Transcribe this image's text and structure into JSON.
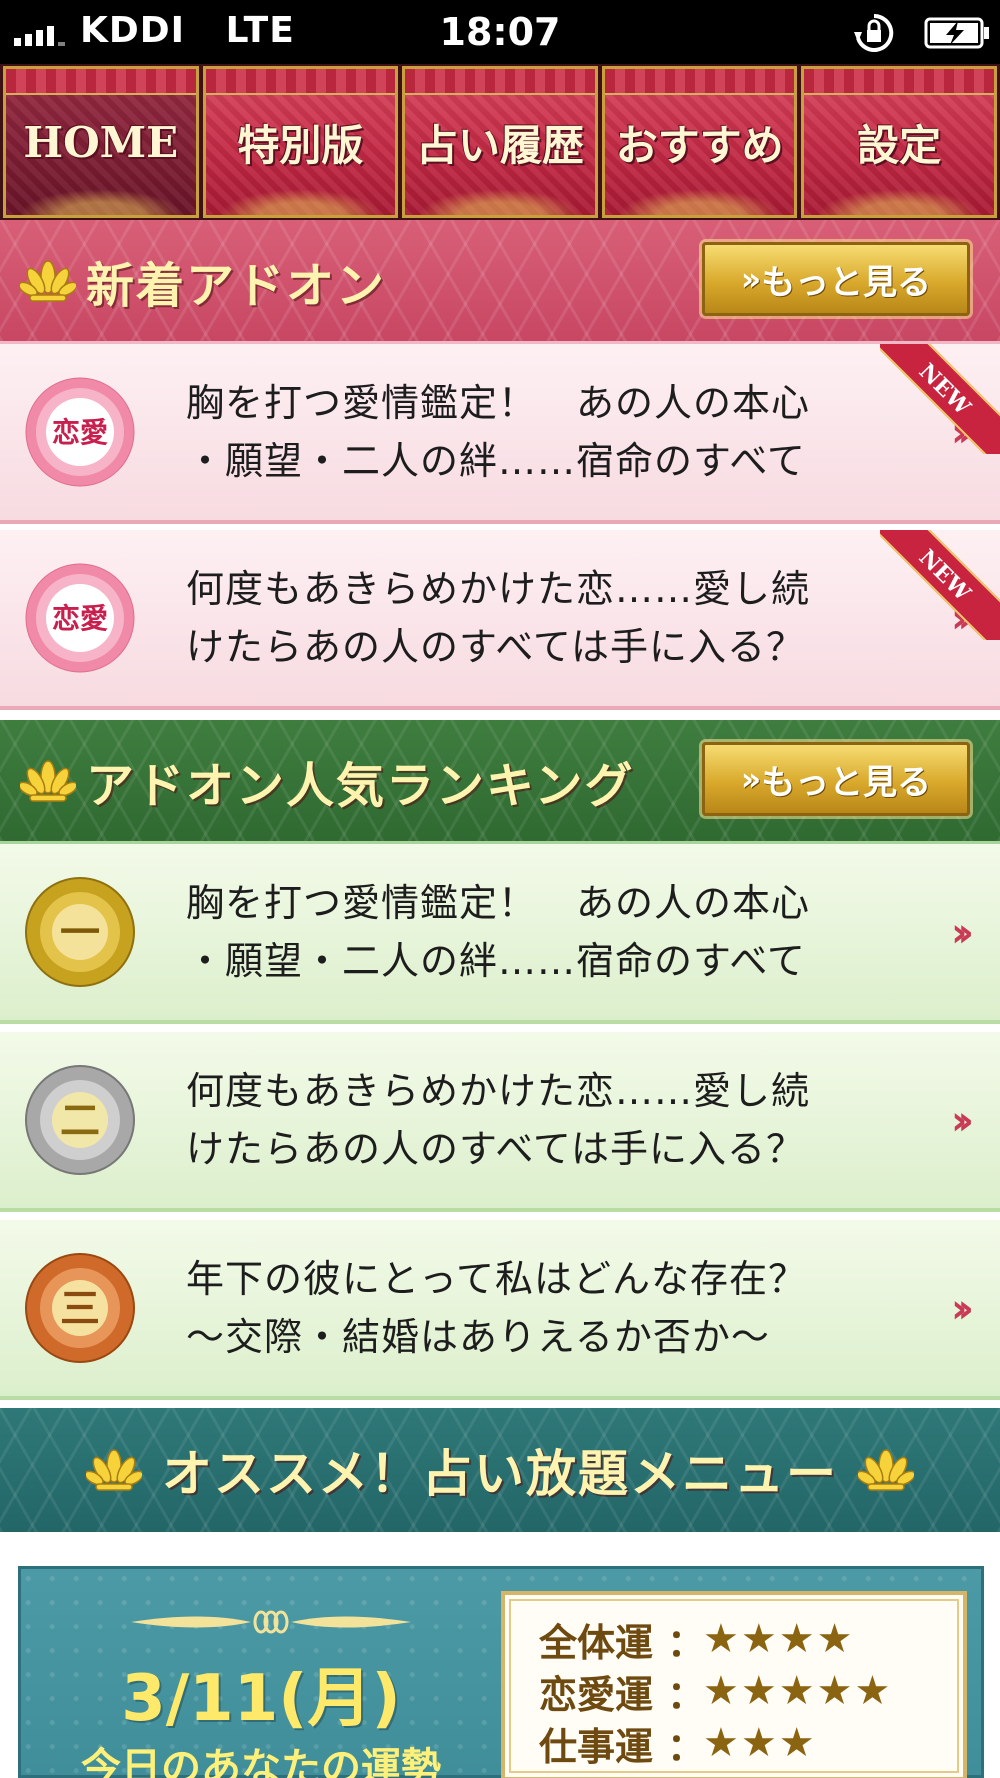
{
  "status_bar": {
    "carrier": "KDDI",
    "network": "LTE",
    "time": "18:07"
  },
  "nav": {
    "tabs": [
      {
        "label": "HOME",
        "active": true
      },
      {
        "label": "特別版",
        "active": false
      },
      {
        "label": "占い履歴",
        "active": false
      },
      {
        "label": "おすすめ",
        "active": false
      },
      {
        "label": "設定",
        "active": false
      }
    ]
  },
  "new_addons": {
    "title": "新着アドオン",
    "more_label": "もっと見る",
    "items": [
      {
        "badge": "恋愛",
        "line1": "胸を打つ愛情鑑定！　あの人の本心",
        "line2": "・願望・二人の絆……宿命のすべて",
        "ribbon": "NEW"
      },
      {
        "badge": "恋愛",
        "line1": "何度もあきらめかけた恋……愛し続",
        "line2": "けたらあの人のすべては手に入る？",
        "ribbon": "NEW"
      }
    ]
  },
  "ranking": {
    "title": "アドオン人気ランキング",
    "more_label": "もっと見る",
    "items": [
      {
        "rank": "一",
        "line1": "胸を打つ愛情鑑定！　あの人の本心",
        "line2": "・願望・二人の絆……宿命のすべて"
      },
      {
        "rank": "二",
        "line1": "何度もあきらめかけた恋……愛し続",
        "line2": "けたらあの人のすべては手に入る？"
      },
      {
        "rank": "三",
        "line1": "年下の彼にとって私はどんな存在？",
        "line2": "～交際・結婚はありえるか否か～"
      }
    ]
  },
  "recommend": {
    "title": "オススメ！占い放題メニュー"
  },
  "fortune": {
    "date": "3/11(月)",
    "caption": "今日のあなたの運勢",
    "rows": [
      {
        "label": "全体運",
        "colon": "：",
        "stars": "★★★★",
        "rating": 4
      },
      {
        "label": "恋愛運",
        "colon": "：",
        "stars": "★★★★★",
        "rating": 5
      },
      {
        "label": "仕事運",
        "colon": "：",
        "stars": "★★★",
        "rating": 3
      }
    ]
  },
  "colors": {
    "accent_red": "#c42a45",
    "header_pink": "#d85f77",
    "header_green": "#3f7d3f",
    "header_teal": "#2f7878",
    "gold": "#d9a92c",
    "title_text": "#fff3b0"
  },
  "icons": {
    "signal": "signal-bars-icon",
    "rotation_lock": "rotation-lock-icon",
    "battery": "battery-charging-icon",
    "lotus": "lotus-icon",
    "chevron": "double-chevron-right-icon"
  }
}
